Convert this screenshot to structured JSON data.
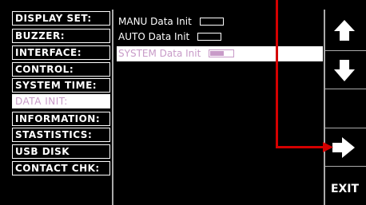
{
  "menu": {
    "items": [
      {
        "label": "DISPLAY SET:"
      },
      {
        "label": "BUZZER:"
      },
      {
        "label": "INTERFACE:"
      },
      {
        "label": "CONTROL:"
      },
      {
        "label": "SYSTEM TIME:"
      },
      {
        "label": "DATA INIT:",
        "selected": true
      },
      {
        "label": "INFORMATION:"
      },
      {
        "label": "STASTISTICS:"
      },
      {
        "label": "USB DISK"
      },
      {
        "label": "CONTACT CHK:"
      }
    ]
  },
  "data_init": {
    "items": [
      {
        "label": "MANU Data Init",
        "progress": 0
      },
      {
        "label": "AUTO Data Init",
        "progress": 0
      },
      {
        "label": "SYSTEM Data Init",
        "progress": 0.6,
        "selected": true
      }
    ]
  },
  "softkeys": {
    "up_icon": "arrow-up-icon",
    "down_icon": "arrow-down-icon",
    "right_icon": "arrow-right-icon",
    "exit_label": "EXIT"
  },
  "colors": {
    "background": "#000000",
    "foreground": "#ffffff",
    "selected_text": "#c89bc8",
    "annotation_arrow": "#d40000"
  }
}
